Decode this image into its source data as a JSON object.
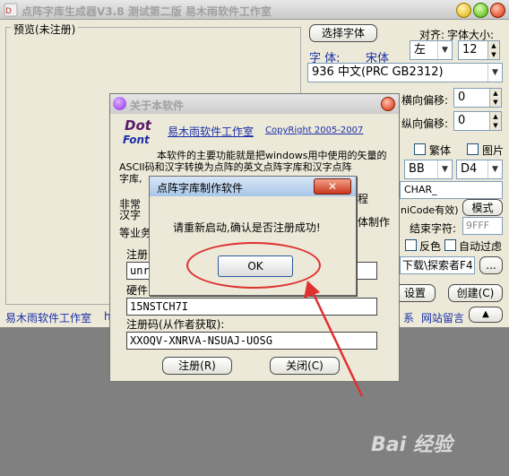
{
  "main": {
    "title": "点阵字库生成器V3.8 测试第二版 易木雨软件工作室",
    "preview_label": "预览(未注册)",
    "select_font_button": "选择字体",
    "align_label": "对齐:",
    "font_size_label": "字体大小:",
    "font_label": "字 体:",
    "font_value": "宋体",
    "align_value": "左",
    "font_size_value": "12",
    "charset_value": "936 中文(PRC GB2312)",
    "h_offset_label": "横向偏移:",
    "h_offset_value": "0",
    "v_offset_label": "纵向偏移:",
    "v_offset_value": "0",
    "traditional_label": "繁体",
    "image_label": "图片",
    "select_bb": "BB",
    "select_d4": "D4",
    "char_field": "CHAR_",
    "unicode_note": "niCode有效)",
    "mode_button": "模式",
    "end_char_label": "结束字符:",
    "end_char_value": "9FFF",
    "invert_label": "反色",
    "auto_filter_label": "自动过虑",
    "download_field": "下载\\探索者F4",
    "browse_button": "...",
    "settings_button": "设置",
    "create_button": "创建(C)",
    "footer_studio": "易木雨软件工作室",
    "footer_prefix": "h",
    "footer_contact": "系",
    "footer_message": "网站留言",
    "footer_toggle": "▲"
  },
  "about": {
    "title": "关于本软件",
    "logo_top": "Dot",
    "logo_bottom": "Font",
    "studio_link": "易木雨软件工作室",
    "copyright": "CopyRight 2005-2007",
    "desc_line1": "本软件的主要功能就是把windows用中使用的矢量的",
    "desc_line2": "ASCII码和汉字转换为点阵的英文点阵字库和汉字点阵",
    "desc_line3": "字库,",
    "desc_frag_left": "非常",
    "desc_frag_left2": "汉字",
    "desc_frag_bottom": "等业务",
    "desc_frag_right": "程",
    "desc_frag_right2": "体制作",
    "reg_user_label": "注册",
    "reg_user_value": "unre",
    "hardware_label": "硬件",
    "hardware_value": "15NSTCH7I",
    "reg_code_label": "注册码(从作者获取):",
    "reg_code_value": "XXOQV-XNRVA-NSUAJ-UOSG",
    "register_button": "注册(R)",
    "close_button": "关闭(C)"
  },
  "restart_dialog": {
    "title": "点阵字库制作软件",
    "close": "✕",
    "message": "请重新启动,确认是否注册成功!",
    "ok": "OK"
  },
  "watermark": "Bai 经验",
  "colors": {
    "link_blue": "#1a2fa8",
    "highlight_red": "#e03030"
  }
}
